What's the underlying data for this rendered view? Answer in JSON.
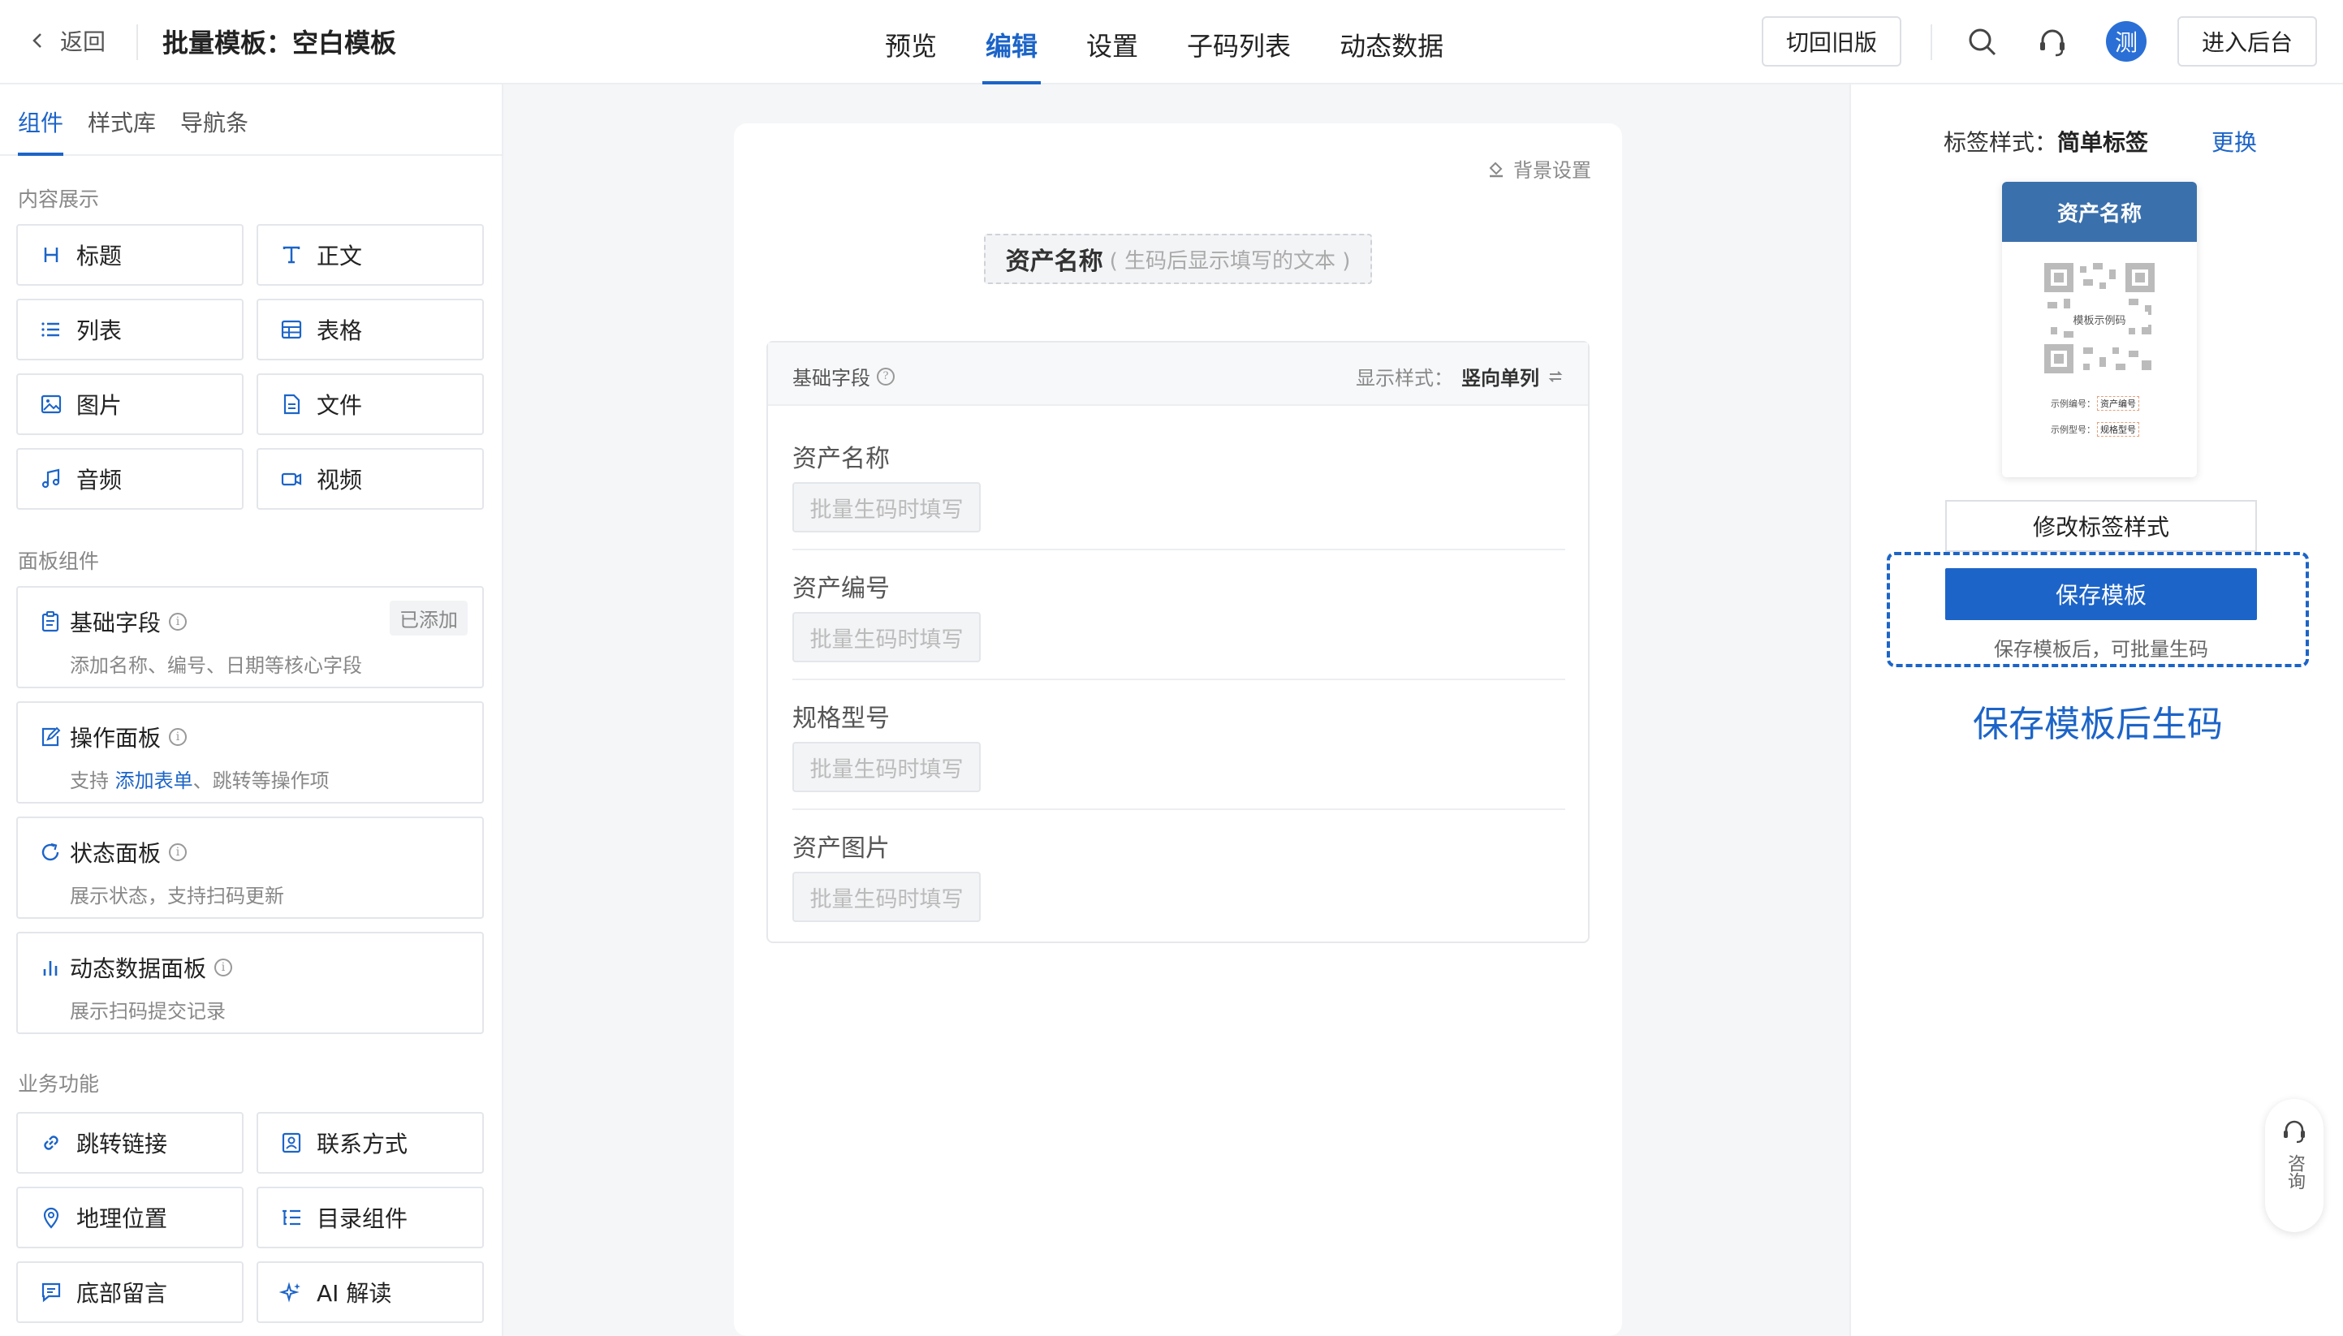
{
  "header": {
    "back_label": "返回",
    "title": "批量模板：空白模板",
    "tabs": [
      {
        "label": "预览"
      },
      {
        "label": "编辑",
        "active": true
      },
      {
        "label": "设置"
      },
      {
        "label": "子码列表"
      },
      {
        "label": "动态数据"
      }
    ],
    "old_version_label": "切回旧版",
    "avatar_text": "测",
    "admin_label": "进入后台"
  },
  "left": {
    "tabs": [
      {
        "label": "组件",
        "active": true
      },
      {
        "label": "样式库"
      },
      {
        "label": "导航条"
      }
    ],
    "content_section": "内容展示",
    "content_items": [
      {
        "label": "标题",
        "icon": "heading-icon"
      },
      {
        "label": "正文",
        "icon": "text-icon"
      },
      {
        "label": "列表",
        "icon": "list-icon"
      },
      {
        "label": "表格",
        "icon": "table-icon"
      },
      {
        "label": "图片",
        "icon": "image-icon"
      },
      {
        "label": "文件",
        "icon": "file-icon"
      },
      {
        "label": "音频",
        "icon": "music-icon"
      },
      {
        "label": "视频",
        "icon": "video-icon"
      }
    ],
    "panel_section": "面板组件",
    "panels": [
      {
        "title": "基础字段",
        "desc": "添加名称、编号、日期等核心字段",
        "badge": "已添加",
        "icon": "clipboard-icon"
      },
      {
        "title": "操作面板",
        "desc_prefix": "支持",
        "desc_link": "添加表单",
        "desc_suffix": "、跳转等操作项",
        "icon": "edit-icon"
      },
      {
        "title": "状态面板",
        "desc": "展示状态，支持扫码更新",
        "icon": "refresh-icon"
      },
      {
        "title": "动态数据面板",
        "desc": "展示扫码提交记录",
        "icon": "bar-chart-icon"
      }
    ],
    "business_section": "业务功能",
    "business_items": [
      {
        "label": "跳转链接",
        "icon": "link-icon"
      },
      {
        "label": "联系方式",
        "icon": "contact-icon"
      },
      {
        "label": "地理位置",
        "icon": "location-icon"
      },
      {
        "label": "目录组件",
        "icon": "catalog-icon"
      },
      {
        "label": "底部留言",
        "icon": "message-icon"
      },
      {
        "label": "AI 解读",
        "icon": "sparkle-icon"
      }
    ]
  },
  "canvas": {
    "bg_setting_label": "背景设置",
    "asset_title": "资产名称",
    "asset_title_hint": "( 生码后显示填写的文本 )",
    "fields_header": "基础字段",
    "display_style_label": "显示样式：",
    "display_style_value": "竖向单列",
    "fields": [
      {
        "label": "资产名称",
        "placeholder": "批量生码时填写"
      },
      {
        "label": "资产编号",
        "placeholder": "批量生码时填写"
      },
      {
        "label": "规格型号",
        "placeholder": "批量生码时填写"
      },
      {
        "label": "资产图片",
        "placeholder": "批量生码时填写"
      }
    ]
  },
  "right": {
    "label_style_prefix": "标签样式：",
    "label_style_value": "简单标签",
    "change_label": "更换",
    "preview": {
      "title": "资产名称",
      "qr_text": "模板示例码",
      "line1_key": "示例编号：",
      "line1_val": "资产编号",
      "line2_key": "示例型号：",
      "line2_val": "规格型号"
    },
    "modify_label": "修改标签样式",
    "save_label": "保存模板",
    "save_hint": "保存模板后，可批量生码",
    "save_big_text": "保存模板后生码"
  },
  "consult_label": "咨询",
  "colors": {
    "accent": "#1c64c8",
    "label_header": "#3a70ac"
  }
}
